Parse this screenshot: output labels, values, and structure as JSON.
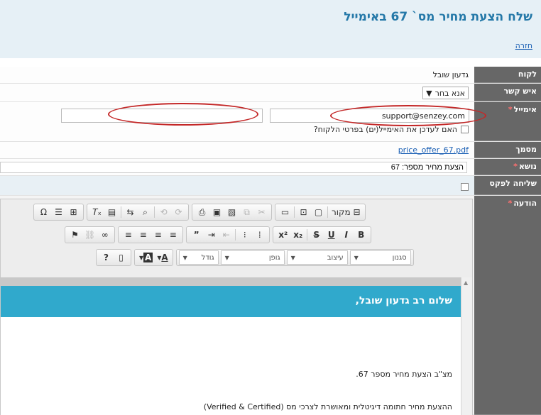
{
  "header": {
    "title": "שלח הצעת מחיר מס` 67 באימייל",
    "back_link": "חזרה"
  },
  "form": {
    "client": {
      "label": "לקוח",
      "value": "גדעון שובל"
    },
    "contact": {
      "label": "איש קשר",
      "select_value": "אנא בחר"
    },
    "email": {
      "label": "אימייל",
      "primary_value": "support@senzey.com",
      "secondary_value": "",
      "update_label": "האם לעדכן את האימייל(ים) בפרטי הלקוח?"
    },
    "document": {
      "label": "מסמך",
      "file": "price_offer_67.pdf"
    },
    "subject": {
      "label": "נושא",
      "value": "הצעת מחיר מספר: 67"
    },
    "fax": {
      "label": "שליחה לפקס"
    },
    "message": {
      "label": "הודעה"
    },
    "required_mark": "*"
  },
  "editor": {
    "toolbar": {
      "source": "מקור",
      "style": "סגנון",
      "format": "עיצוב",
      "font": "גופן",
      "size": "גודל",
      "help": "?"
    },
    "content": {
      "greeting": "שלום רב גדעון שובל,",
      "line1": "מצ\"ב הצעת מחיר מספר 67.",
      "line2": "ההצעת מחיר חתומה דיגיטלית ומאושרת לצרכי מס (Verified & Certified)"
    }
  },
  "colors": {
    "accent": "#2478a8",
    "label_bg": "#676767",
    "header_bg": "#30a9cc",
    "highlight": "#c42828"
  }
}
